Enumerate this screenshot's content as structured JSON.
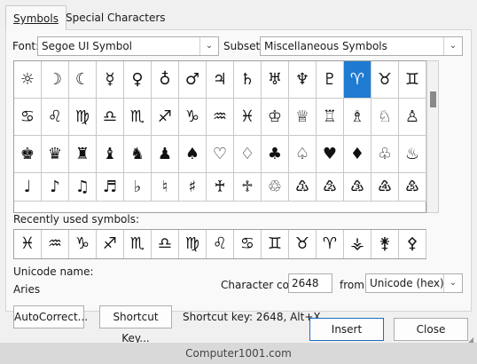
{
  "tabs": [
    {
      "label": "Symbols"
    },
    {
      "label": "Special Characters"
    }
  ],
  "font": {
    "label": "Font:",
    "value": "Segoe UI Symbol"
  },
  "subset": {
    "label": "Subset:",
    "value": "Miscellaneous Symbols"
  },
  "symbols_rows": [
    [
      "☼",
      "☽",
      "☾",
      "☿",
      "♀",
      "♁",
      "♂",
      "♃",
      "♄",
      "♅",
      "♆",
      "♇",
      "♈",
      "♉",
      "♊"
    ],
    [
      "♋",
      "♌",
      "♍",
      "♎",
      "♏",
      "♐",
      "♑",
      "♒",
      "♓",
      "♔",
      "♕",
      "♖",
      "♗",
      "♘",
      "♙"
    ],
    [
      "♚",
      "♛",
      "♜",
      "♝",
      "♞",
      "♟",
      "♠",
      "♡",
      "♢",
      "♣",
      "♤",
      "♥",
      "♦",
      "♧",
      "♨"
    ],
    [
      "♩",
      "♪",
      "♫",
      "♬",
      "♭",
      "♮",
      "♯",
      "♰",
      "♱",
      "♲",
      "♳",
      "♴",
      "♵",
      "♶",
      "♷"
    ]
  ],
  "recent": {
    "label": "Recently used symbols:",
    "symbols": [
      "♓",
      "♒",
      "♑",
      "♐",
      "♏",
      "♎",
      "♍",
      "♌",
      "♋",
      "♊",
      "♉",
      "♈",
      "⚶",
      "⚵",
      "⚴"
    ]
  },
  "unicode_name": {
    "label": "Unicode name:",
    "value": "Aries"
  },
  "char_code": {
    "label": "Character code:",
    "value": "2648"
  },
  "from": {
    "label": "from:",
    "value": "Unicode (hex)"
  },
  "buttons": {
    "autocorrect": "AutoCorrect...",
    "shortcut_key": "Shortcut Key...",
    "insert": "Insert",
    "close": "Close"
  },
  "shortcut_text": "Shortcut key: 2648, Alt+X",
  "footer": "Computer1001.com"
}
